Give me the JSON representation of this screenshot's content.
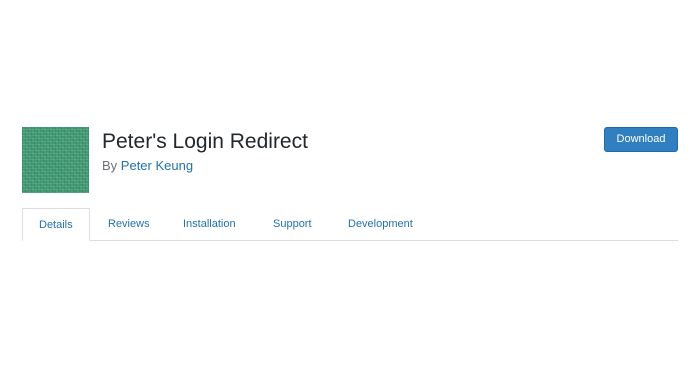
{
  "plugin": {
    "title": "Peter's Login Redirect",
    "byline_prefix": "By",
    "author": "Peter Keung",
    "icon": "plugin-banner-icon"
  },
  "actions": {
    "download_label": "Download"
  },
  "tabs": [
    {
      "label": "Details",
      "active": true
    },
    {
      "label": "Reviews",
      "active": false
    },
    {
      "label": "Installation",
      "active": false
    },
    {
      "label": "Support",
      "active": false
    },
    {
      "label": "Development",
      "active": false
    }
  ],
  "colors": {
    "link": "#2271b1",
    "button": "#2f7fc1",
    "icon": "#3f9a73",
    "title": "#23282d"
  }
}
